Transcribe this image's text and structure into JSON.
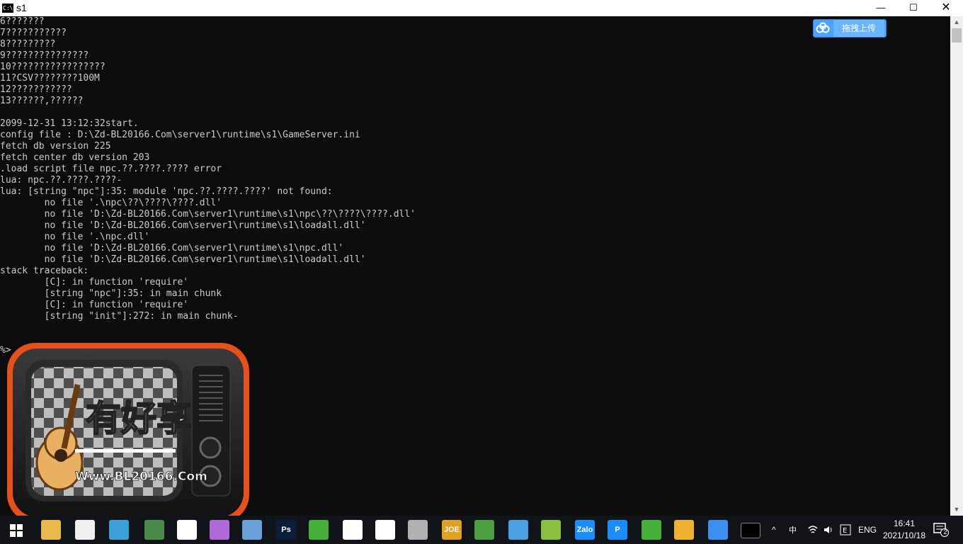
{
  "window": {
    "title": "s1",
    "icon_text": "C:\\",
    "minimize_symbol": "—",
    "maximize_symbol": "☐",
    "close_symbol": "✕"
  },
  "console_lines": [
    "6???????",
    "7???????????",
    "8?????????",
    "9???????????????",
    "10?????????????????",
    "11?CSV????????100M",
    "12???????????",
    "13??????,??????",
    "",
    "2099-12-31 13:12:32start.",
    "config file : D:\\Zd-BL20166.Com\\server1\\runtime\\s1\\GameServer.ini",
    "fetch db version 225",
    "fetch center db version 203",
    ".load script file npc.??.????.???? error",
    "lua: npc.??.????.????-",
    "lua: [string \"npc\"]:35: module 'npc.??.????.????' not found:",
    "        no file '.\\npc\\??\\????\\????.dll'",
    "        no file 'D:\\Zd-BL20166.Com\\server1\\runtime\\s1\\npc\\??\\????\\????.dll'",
    "        no file 'D:\\Zd-BL20166.Com\\server1\\runtime\\s1\\loadall.dll'",
    "        no file '.\\npc.dll'",
    "        no file 'D:\\Zd-BL20166.Com\\server1\\runtime\\s1\\npc.dll'",
    "        no file 'D:\\Zd-BL20166.Com\\server1\\runtime\\s1\\loadall.dll'",
    "stack traceback:",
    "        [C]: in function 'require'",
    "        [string \"npc\"]:35: in main chunk",
    "        [C]: in function 'require'",
    "        [string \"init\"]:272: in main chunk-",
    "",
    "",
    "%>"
  ],
  "overlay_button": {
    "label": "拖拽上传",
    "icon": "baidu-cloud-icon"
  },
  "watermark": {
    "brand_text": "有好享",
    "url_text": "Www.BL20166.Com",
    "icon": "retro-tv-guitar-logo"
  },
  "taskbar": {
    "apps": [
      {
        "name": "file-explorer",
        "icon": "folder-icon",
        "color": "#e8b84a"
      },
      {
        "name": "notepad",
        "icon": "notepad-icon",
        "color": "#f0f0f0"
      },
      {
        "name": "tool",
        "icon": "circle-icon",
        "color": "#3aa0d8"
      },
      {
        "name": "network",
        "icon": "network-icon",
        "color": "#4a8a4a"
      },
      {
        "name": "app",
        "icon": "window-icon",
        "color": "#ffffff"
      },
      {
        "name": "game",
        "icon": "game-icon",
        "color": "#b06ad8"
      },
      {
        "name": "tool2",
        "icon": "tool-icon",
        "color": "#6aa0d8"
      },
      {
        "name": "photoshop",
        "icon": "ps-icon",
        "text": "Ps",
        "color": "#0a1e3c"
      },
      {
        "name": "bluestacks",
        "icon": "layers-icon",
        "color": "#46b03a"
      },
      {
        "name": "unity",
        "icon": "unity-icon",
        "color": "#ffffff"
      },
      {
        "name": "unity2",
        "icon": "unity-icon",
        "color": "#ffffff"
      },
      {
        "name": "database",
        "icon": "database-icon",
        "color": "#b0b0b0"
      },
      {
        "name": "joe",
        "icon": "joe-icon",
        "text": "JOE",
        "color": "#e0a020"
      },
      {
        "name": "green-app",
        "icon": "green-circle-icon",
        "color": "#4aa040"
      },
      {
        "name": "monitor",
        "icon": "monitor-icon",
        "color": "#4aa0e0"
      },
      {
        "name": "editor",
        "icon": "editor-icon",
        "color": "#8ac040"
      },
      {
        "name": "zalo",
        "icon": "zalo-icon",
        "text": "Zalo",
        "color": "#1a8cff"
      },
      {
        "name": "p-app",
        "icon": "p-icon",
        "text": "P",
        "color": "#1a8cff"
      },
      {
        "name": "bluestacks2",
        "icon": "layers-icon",
        "color": "#46b03a"
      },
      {
        "name": "sketch",
        "icon": "sketch-icon",
        "color": "#f0b030"
      },
      {
        "name": "baidu-netdisk",
        "icon": "baidu-cloud-icon",
        "color": "#3a8ff0"
      },
      {
        "name": "cmd",
        "icon": "cmd-icon",
        "color": "#000000"
      }
    ],
    "tray": {
      "chevron": "^",
      "lang": "ENG",
      "time": "16:41",
      "date": "2021/10/18",
      "notification_count": "2"
    }
  }
}
